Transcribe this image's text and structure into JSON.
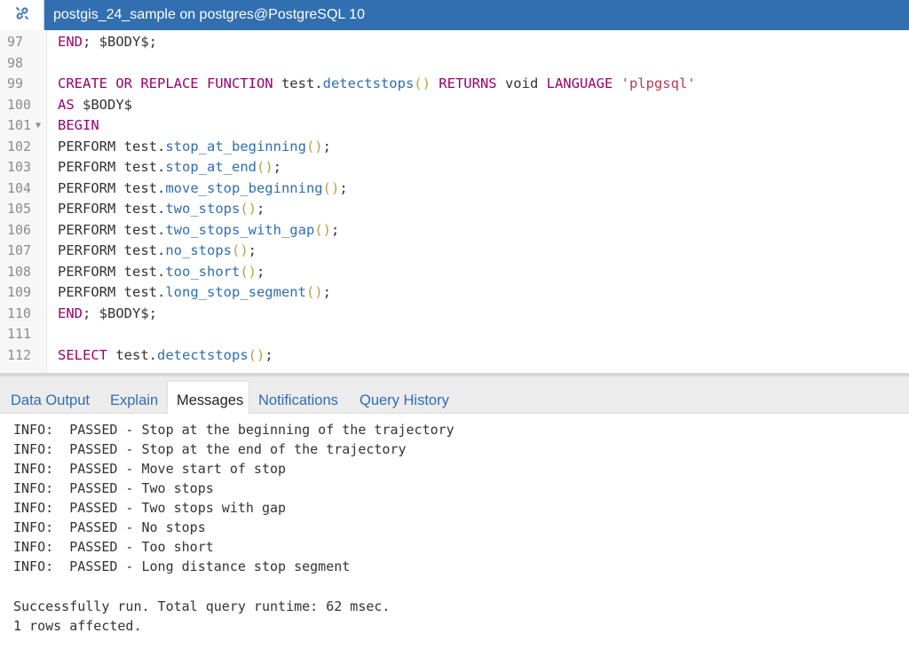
{
  "titlebar": {
    "connection_icon": "connection-link-icon",
    "title": "postgis_24_sample on postgres@PostgreSQL 10"
  },
  "editor": {
    "lines": [
      {
        "num": "97",
        "code": [
          {
            "t": "END",
            "c": "kw"
          },
          {
            "t": "; $BODY$;",
            "c": ""
          }
        ]
      },
      {
        "num": "98",
        "code": []
      },
      {
        "num": "99",
        "code": [
          {
            "t": "CREATE OR REPLACE FUNCTION",
            "c": "kw"
          },
          {
            "t": " test.",
            "c": ""
          },
          {
            "t": "detectstops",
            "c": "fn"
          },
          {
            "t": "()",
            "c": "paren"
          },
          {
            "t": " RETURNS",
            "c": "kw"
          },
          {
            "t": " void ",
            "c": ""
          },
          {
            "t": "LANGUAGE",
            "c": "kw"
          },
          {
            "t": " ",
            "c": ""
          },
          {
            "t": "'plpgsql'",
            "c": "str"
          }
        ]
      },
      {
        "num": "100",
        "code": [
          {
            "t": "AS",
            "c": "kw"
          },
          {
            "t": " $BODY$",
            "c": ""
          }
        ]
      },
      {
        "num": "101",
        "fold": true,
        "code": [
          {
            "t": "BEGIN",
            "c": "kw"
          }
        ]
      },
      {
        "num": "102",
        "code": [
          {
            "t": "PERFORM test.",
            "c": ""
          },
          {
            "t": "stop_at_beginning",
            "c": "fn"
          },
          {
            "t": "()",
            "c": "paren"
          },
          {
            "t": ";",
            "c": ""
          }
        ]
      },
      {
        "num": "103",
        "code": [
          {
            "t": "PERFORM test.",
            "c": ""
          },
          {
            "t": "stop_at_end",
            "c": "fn"
          },
          {
            "t": "()",
            "c": "paren"
          },
          {
            "t": ";",
            "c": ""
          }
        ]
      },
      {
        "num": "104",
        "code": [
          {
            "t": "PERFORM test.",
            "c": ""
          },
          {
            "t": "move_stop_beginning",
            "c": "fn"
          },
          {
            "t": "()",
            "c": "paren"
          },
          {
            "t": ";",
            "c": ""
          }
        ]
      },
      {
        "num": "105",
        "code": [
          {
            "t": "PERFORM test.",
            "c": ""
          },
          {
            "t": "two_stops",
            "c": "fn"
          },
          {
            "t": "()",
            "c": "paren"
          },
          {
            "t": ";",
            "c": ""
          }
        ]
      },
      {
        "num": "106",
        "code": [
          {
            "t": "PERFORM test.",
            "c": ""
          },
          {
            "t": "two_stops_with_gap",
            "c": "fn"
          },
          {
            "t": "()",
            "c": "paren"
          },
          {
            "t": ";",
            "c": ""
          }
        ]
      },
      {
        "num": "107",
        "code": [
          {
            "t": "PERFORM test.",
            "c": ""
          },
          {
            "t": "no_stops",
            "c": "fn"
          },
          {
            "t": "()",
            "c": "paren"
          },
          {
            "t": ";",
            "c": ""
          }
        ]
      },
      {
        "num": "108",
        "code": [
          {
            "t": "PERFORM test.",
            "c": ""
          },
          {
            "t": "too_short",
            "c": "fn"
          },
          {
            "t": "()",
            "c": "paren"
          },
          {
            "t": ";",
            "c": ""
          }
        ]
      },
      {
        "num": "109",
        "code": [
          {
            "t": "PERFORM test.",
            "c": ""
          },
          {
            "t": "long_stop_segment",
            "c": "fn"
          },
          {
            "t": "()",
            "c": "paren"
          },
          {
            "t": ";",
            "c": ""
          }
        ]
      },
      {
        "num": "110",
        "code": [
          {
            "t": "END",
            "c": "kw"
          },
          {
            "t": "; $BODY$;",
            "c": ""
          }
        ]
      },
      {
        "num": "111",
        "code": []
      },
      {
        "num": "112",
        "code": [
          {
            "t": "SELECT",
            "c": "kw"
          },
          {
            "t": " test.",
            "c": ""
          },
          {
            "t": "detectstops",
            "c": "fn"
          },
          {
            "t": "()",
            "c": "paren"
          },
          {
            "t": ";",
            "c": ""
          }
        ]
      }
    ]
  },
  "tabs": [
    {
      "label": "Data Output",
      "active": false
    },
    {
      "label": "Explain",
      "active": false
    },
    {
      "label": "Messages",
      "active": true
    },
    {
      "label": "Notifications",
      "active": false
    },
    {
      "label": "Query History",
      "active": false
    }
  ],
  "messages": {
    "lines": [
      "INFO:  PASSED - Stop at the beginning of the trajectory",
      "INFO:  PASSED - Stop at the end of the trajectory",
      "INFO:  PASSED - Move start of stop",
      "INFO:  PASSED - Two stops",
      "INFO:  PASSED - Two stops with gap",
      "INFO:  PASSED - No stops",
      "INFO:  PASSED - Too short",
      "INFO:  PASSED - Long distance stop segment"
    ],
    "summary": "Successfully run. Total query runtime: 62 msec.",
    "rows_affected": "1 rows affected."
  },
  "colors": {
    "titlebar": "#326fb0",
    "keyword": "#990073",
    "function": "#2f6db5",
    "string": "#b53c56",
    "tab_link": "#2f6db5"
  }
}
